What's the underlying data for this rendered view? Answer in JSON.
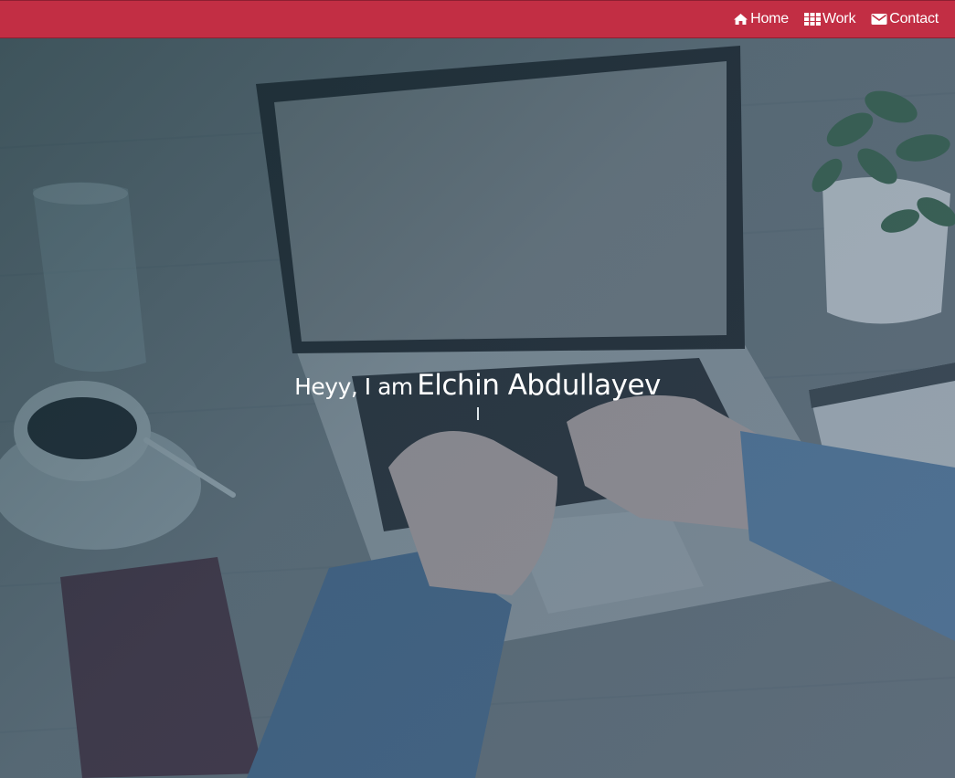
{
  "nav": {
    "items": [
      {
        "label": "Home",
        "icon": "home-icon"
      },
      {
        "label": "Work",
        "icon": "grid-icon"
      },
      {
        "label": "Contact",
        "icon": "envelope-icon"
      }
    ]
  },
  "hero": {
    "greeting": "Heyy, I am",
    "name": "Elchin Abdullayev"
  },
  "colors": {
    "navbar": "#c22e44",
    "text": "#ffffff"
  }
}
